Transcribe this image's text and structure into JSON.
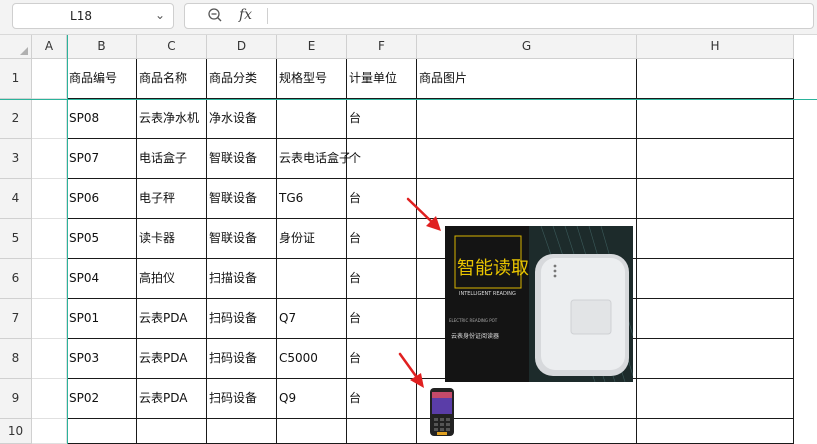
{
  "toolbar": {
    "name_box": "L18",
    "fx_label": "fx",
    "formula_value": ""
  },
  "columns": [
    "A",
    "B",
    "C",
    "D",
    "E",
    "F",
    "G",
    "H"
  ],
  "rows": [
    {
      "num": "1",
      "cells": [
        "",
        "商品编号",
        "商品名称",
        "商品分类",
        "规格型号",
        "计量单位",
        "商品图片",
        ""
      ]
    },
    {
      "num": "2",
      "cells": [
        "",
        "SP08",
        "云表净水机",
        "净水设备",
        "",
        "台",
        "",
        ""
      ]
    },
    {
      "num": "3",
      "cells": [
        "",
        "SP07",
        "电话盒子",
        "智联设备",
        "云表电话盒子",
        "个",
        "",
        ""
      ]
    },
    {
      "num": "4",
      "cells": [
        "",
        "SP06",
        "电子秤",
        "智联设备",
        "TG6",
        "台",
        "",
        ""
      ]
    },
    {
      "num": "5",
      "cells": [
        "",
        "SP05",
        "读卡器",
        "智联设备",
        "身份证",
        "台",
        "",
        ""
      ]
    },
    {
      "num": "6",
      "cells": [
        "",
        "SP04",
        "高拍仪",
        "扫描设备",
        "",
        "台",
        "",
        ""
      ]
    },
    {
      "num": "7",
      "cells": [
        "",
        "SP01",
        "云表PDA",
        "扫码设备",
        "Q7",
        "台",
        "",
        ""
      ]
    },
    {
      "num": "8",
      "cells": [
        "",
        "SP03",
        "云表PDA",
        "扫码设备",
        "C5000",
        "台",
        "",
        ""
      ]
    },
    {
      "num": "9",
      "cells": [
        "",
        "SP02",
        "云表PDA",
        "扫码设备",
        "Q9",
        "台",
        "",
        ""
      ]
    },
    {
      "num": "10",
      "cells": [
        "",
        "",
        "",
        "",
        "",
        "",
        "",
        ""
      ]
    }
  ],
  "product_image": {
    "headline": "智能读取",
    "subtitle": "INTELLIGENT READING",
    "small_en": "ELECTRIC READING POT",
    "caption": "云表身份证阅读器"
  },
  "colors": {
    "freeze_line": "#2bb39b",
    "arrow": "#e02020",
    "header_bg": "#f3f3f3"
  }
}
